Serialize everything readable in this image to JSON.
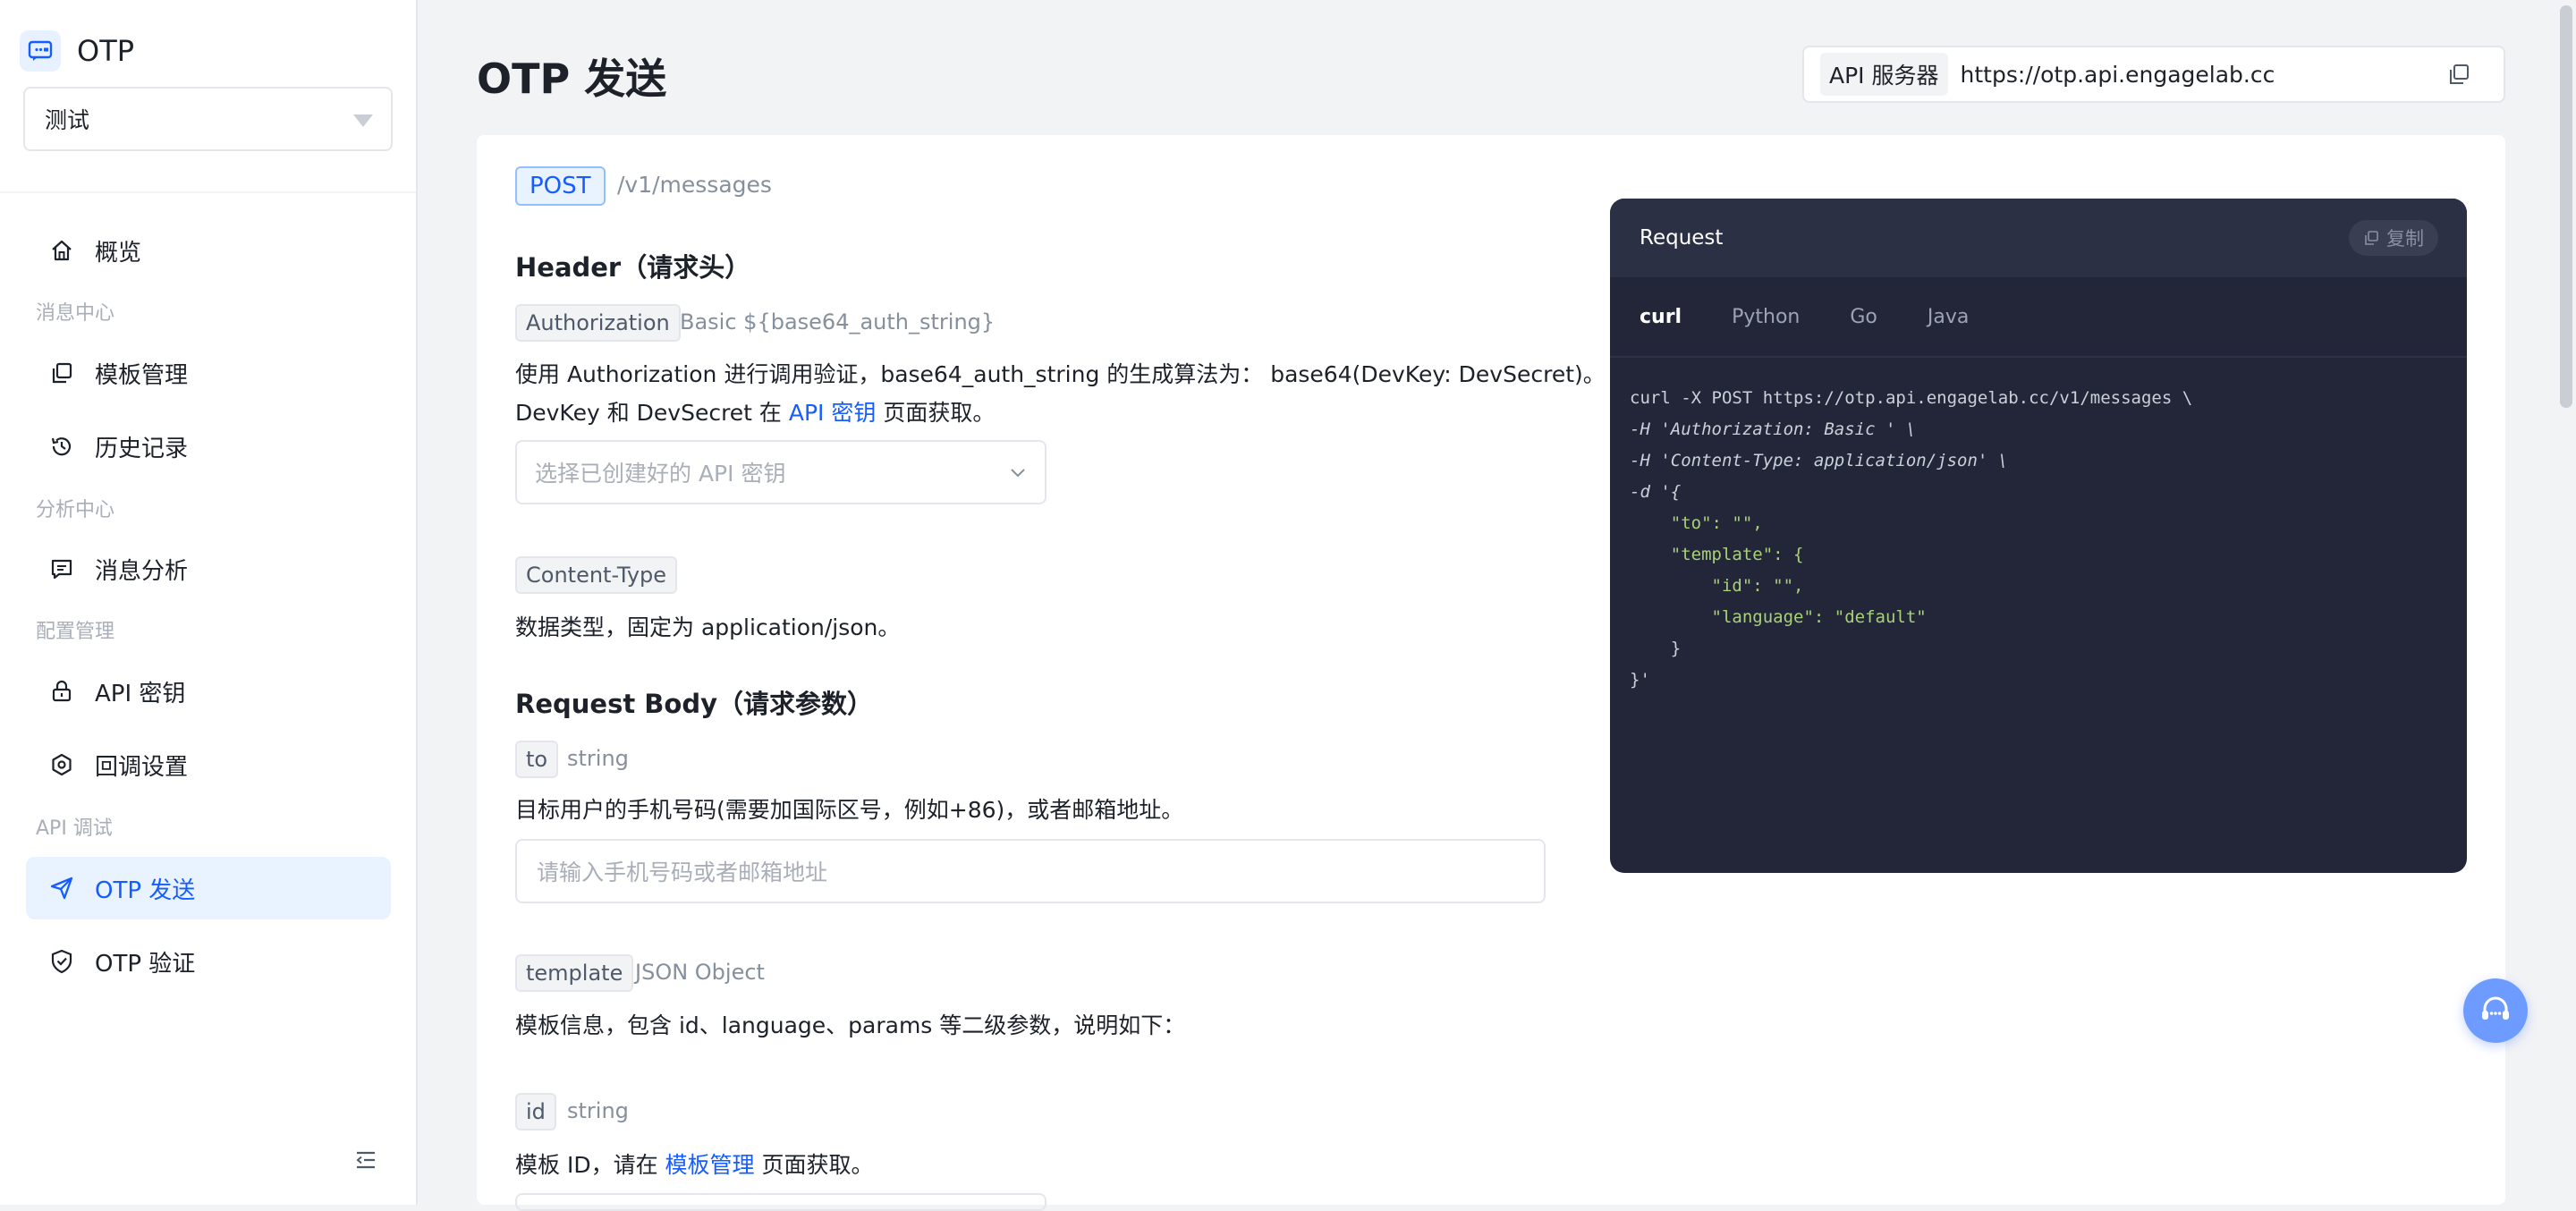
{
  "app": {
    "name": "OTP",
    "project": "测试"
  },
  "sidebar": {
    "items": [
      {
        "label": "概览"
      },
      {
        "group": "消息中心"
      },
      {
        "label": "模板管理"
      },
      {
        "label": "历史记录"
      },
      {
        "group": "分析中心"
      },
      {
        "label": "消息分析"
      },
      {
        "group": "配置管理"
      },
      {
        "label": "API 密钥"
      },
      {
        "label": "回调设置"
      },
      {
        "group": "API 调试"
      },
      {
        "label": "OTP 发送"
      },
      {
        "label": "OTP 验证"
      }
    ]
  },
  "header": {
    "title": "OTP 发送",
    "server_label": "API 服务器",
    "server_url": "https://otp.api.engagelab.cc"
  },
  "endpoint": {
    "method": "POST",
    "path": "/v1/messages"
  },
  "header_section": {
    "title": "Header（请求头）",
    "auth_tag": "Authorization",
    "auth_value": "Basic ${base64_auth_string}",
    "auth_desc_1": "使用 Authorization 进行调用验证，base64_auth_string 的生成算法为： base64(DevKey: DevSecret)。",
    "auth_desc_2a": "DevKey 和 DevSecret 在 ",
    "auth_desc_2_link": "API 密钥",
    "auth_desc_2b": " 页面获取。",
    "key_select_placeholder": "选择已创建好的 API 密钥",
    "ct_tag": "Content-Type",
    "ct_desc": "数据类型，固定为 application/json。"
  },
  "body_section": {
    "title": "Request Body（请求参数）",
    "to_tag": "to",
    "to_type": "string",
    "to_desc": "目标用户的手机号码(需要加国际区号，例如+86)，或者邮箱地址。",
    "to_placeholder": "请输入手机号码或者邮箱地址",
    "template_tag": "template",
    "template_type": "JSON Object",
    "template_desc": "模板信息，包含 id、language、params 等二级参数，说明如下：",
    "id_tag": "id",
    "id_type": "string",
    "id_desc_a": "模板 ID，请在 ",
    "id_desc_link": "模板管理",
    "id_desc_b": " 页面获取。"
  },
  "code_panel": {
    "title": "Request",
    "copy_label": "复制",
    "tabs": [
      "curl",
      "Python",
      "Go",
      "Java"
    ],
    "active_tab": "curl",
    "lines": [
      "curl -X POST https://otp.api.engagelab.cc/v1/messages \\",
      "-H 'Authorization: Basic ' \\",
      "-H 'Content-Type: application/json' \\",
      "-d '{",
      "    \"to\": \"\",",
      "    \"template\": {",
      "        \"id\": \"\",",
      "        \"language\": \"default\"",
      "    }",
      "}'"
    ]
  },
  "colors": {
    "accent": "#165dff",
    "active_bg": "#e8f3ff",
    "code_bg": "#232639"
  }
}
